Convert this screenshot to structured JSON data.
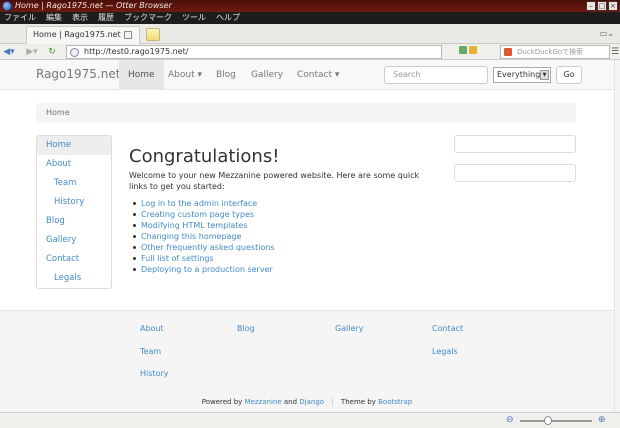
{
  "window": {
    "title": "Home | Rago1975.net — Otter Browser"
  },
  "menu": [
    "ファイル",
    "編集",
    "表示",
    "履歴",
    "ブックマーク",
    "ツール",
    "ヘルプ"
  ],
  "tab": {
    "label": "Home | Rago1975.net"
  },
  "address": {
    "url": "http://test0.rago1975.net/",
    "search_placeholder": "DuckDuckGoで検索"
  },
  "site": {
    "brand": "Rago1975.net",
    "nav": [
      "Home",
      "About ▾",
      "Blog",
      "Gallery",
      "Contact ▾"
    ],
    "search_placeholder": "Search",
    "search_scope": "Everything",
    "go_label": "Go",
    "breadcrumb": "Home",
    "sidebar": [
      "Home",
      "About",
      "Team",
      "History",
      "Blog",
      "Gallery",
      "Contact",
      "Legals"
    ],
    "heading": "Congratulations!",
    "intro": "Welcome to your new Mezzanine powered website. Here are some quick links to get you started:",
    "links": [
      "Log in to the admin interface",
      "Creating custom page types",
      "Modifying HTML templates",
      "Changing this homepage",
      "Other frequently asked questions",
      "Full list of settings",
      "Deploying to a production server"
    ],
    "footer": {
      "col1": [
        "About",
        "Team",
        "History"
      ],
      "col2": [
        "Blog"
      ],
      "col3": [
        "Gallery"
      ],
      "col4": [
        "Contact",
        "Legals"
      ],
      "powered_prefix": "Powered by",
      "mezzanine": "Mezzanine",
      "and": "and",
      "django": "Django",
      "separator": "|",
      "theme_prefix": "Theme by",
      "bootstrap": "Bootstrap"
    }
  },
  "colors": {
    "link": "#428bca",
    "titlebar": "#5a140c"
  }
}
